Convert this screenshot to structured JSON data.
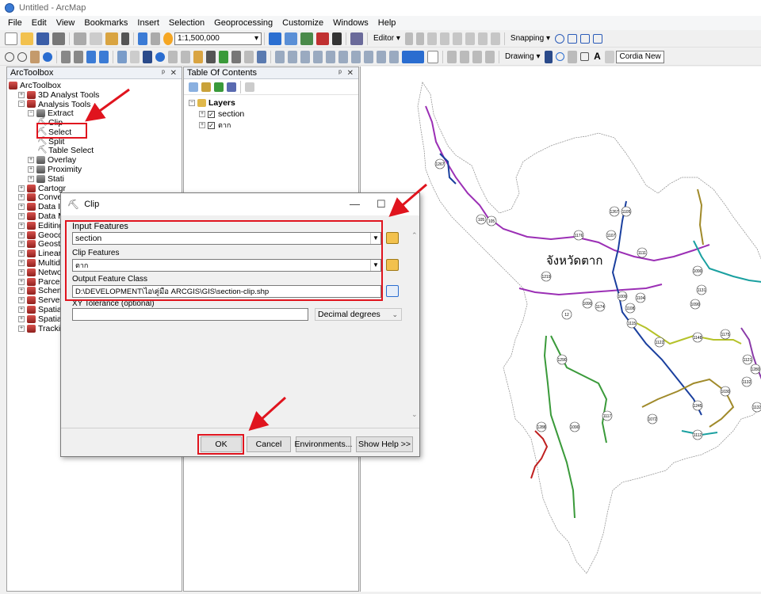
{
  "window_title": "Untitled - ArcMap",
  "menu": [
    "File",
    "Edit",
    "View",
    "Bookmarks",
    "Insert",
    "Selection",
    "Geoprocessing",
    "Customize",
    "Windows",
    "Help"
  ],
  "toolbar": {
    "scale": "1:1,500,000",
    "editor": "Editor ▾",
    "snapping": "Snapping ▾",
    "drawing": "Drawing ▾",
    "font": "Cordia New"
  },
  "arctoolbox": {
    "title": "ArcToolbox",
    "items": [
      {
        "label": "ArcToolbox",
        "indent": 0,
        "type": "root"
      },
      {
        "label": "3D Analyst Tools",
        "indent": 1,
        "type": "toolbox",
        "exp": "+"
      },
      {
        "label": "Analysis Tools",
        "indent": 1,
        "type": "toolbox",
        "exp": "−"
      },
      {
        "label": "Extract",
        "indent": 2,
        "type": "toolset",
        "exp": "−"
      },
      {
        "label": "Clip",
        "indent": 3,
        "type": "tool"
      },
      {
        "label": "Select",
        "indent": 3,
        "type": "tool"
      },
      {
        "label": "Split",
        "indent": 3,
        "type": "tool"
      },
      {
        "label": "Table Select",
        "indent": 3,
        "type": "tool"
      },
      {
        "label": "Overlay",
        "indent": 2,
        "type": "toolset",
        "exp": "+"
      },
      {
        "label": "Proximity",
        "indent": 2,
        "type": "toolset",
        "exp": "+"
      },
      {
        "label": "Stati",
        "indent": 2,
        "type": "toolset",
        "exp": "+"
      },
      {
        "label": "Cartogr",
        "indent": 1,
        "type": "toolbox",
        "exp": "+"
      },
      {
        "label": "Convers",
        "indent": 1,
        "type": "toolbox",
        "exp": "+"
      },
      {
        "label": "Data Int",
        "indent": 1,
        "type": "toolbox",
        "exp": "+"
      },
      {
        "label": "Data Ma",
        "indent": 1,
        "type": "toolbox",
        "exp": "+"
      },
      {
        "label": "Editing",
        "indent": 1,
        "type": "toolbox",
        "exp": "+"
      },
      {
        "label": "Geocod",
        "indent": 1,
        "type": "toolbox",
        "exp": "+"
      },
      {
        "label": "Geostat",
        "indent": 1,
        "type": "toolbox",
        "exp": "+"
      },
      {
        "label": "Linear R",
        "indent": 1,
        "type": "toolbox",
        "exp": "+"
      },
      {
        "label": "Multidir",
        "indent": 1,
        "type": "toolbox",
        "exp": "+"
      },
      {
        "label": "Networl",
        "indent": 1,
        "type": "toolbox",
        "exp": "+"
      },
      {
        "label": "Parcel F",
        "indent": 1,
        "type": "toolbox",
        "exp": "+"
      },
      {
        "label": "Schema",
        "indent": 1,
        "type": "toolbox",
        "exp": "+"
      },
      {
        "label": "Server T",
        "indent": 1,
        "type": "toolbox",
        "exp": "+"
      },
      {
        "label": "Spatial A",
        "indent": 1,
        "type": "toolbox",
        "exp": "+"
      },
      {
        "label": "Spatial S",
        "indent": 1,
        "type": "toolbox",
        "exp": "+"
      },
      {
        "label": "Trackin",
        "indent": 1,
        "type": "toolbox",
        "exp": "+"
      }
    ]
  },
  "toc": {
    "title": "Table Of Contents",
    "group": "Layers",
    "layers": [
      "section",
      "ตาก"
    ]
  },
  "dialog": {
    "title": "Clip",
    "input_label": "Input Features",
    "input_value": "section",
    "clip_label": "Clip Features",
    "clip_value": "ตาก",
    "output_label": "Output Feature Class",
    "output_value": "D:\\DEVELOPMENT\\ไอ\\คู่มือ ARCGIS\\GIS\\section-clip.shp",
    "tolerance_label": "XY Tolerance (optional)",
    "tolerance_value": "",
    "units_value": "Decimal degrees",
    "buttons": {
      "ok": "OK",
      "cancel": "Cancel",
      "environments": "Environments...",
      "help": "Show Help >>"
    }
  },
  "map": {
    "province_label": "จังหวัดตาก",
    "route_labels": [
      "1267",
      "1176",
      "1107",
      "1105",
      "1111",
      "105",
      "1219",
      "1090",
      "1009",
      "1104",
      "1131",
      "12",
      "1174",
      "1108",
      "1090",
      "1115",
      "1122",
      "1148",
      "1280",
      "1175",
      "1132",
      "1030",
      "1245",
      "1132",
      "1290",
      "1117",
      "1072",
      "1090",
      "1090",
      "1112",
      "1288",
      "1267",
      "105",
      "1121"
    ]
  },
  "colors": {
    "highlight": "#e0141e",
    "magenta": "#9b2fb5",
    "green": "#3a9a3a",
    "blue": "#1a3f9e",
    "olive": "#a08a2a",
    "teal": "#1aa0a0",
    "red_route": "#c02020",
    "yellowgreen": "#b5c22a"
  }
}
